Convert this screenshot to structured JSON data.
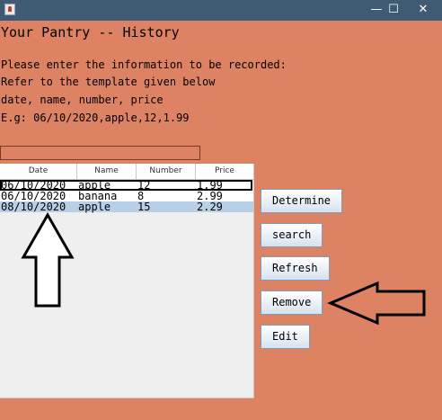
{
  "window": {
    "minimize_glyph": "—",
    "maximize_glyph": "☐",
    "close_glyph": "✕"
  },
  "heading": "Your Pantry -- History",
  "instructions": [
    "Please enter the information to be recorded:",
    "Refer to the template given below",
    "date, name, number, price",
    "E.g: 06/10/2020,apple,12,1.99"
  ],
  "input": {
    "value": ""
  },
  "table": {
    "columns": [
      "Date",
      "Name",
      "Number",
      "Price"
    ],
    "rows": [
      [
        "06/10/2020",
        "apple",
        "12",
        "1.99"
      ],
      [
        "06/10/2020",
        "banana",
        "8",
        "2.99"
      ],
      [
        "08/10/2020",
        "apple",
        "15",
        "2.29"
      ]
    ],
    "selected_row": 2
  },
  "buttons": {
    "determine": "Determine",
    "search": "search",
    "refresh": "Refresh",
    "remove": "Remove",
    "edit": "Edit"
  },
  "colors": {
    "background": "#de8264",
    "titlebar": "#3f5a73",
    "selection": "#b8cfe5"
  }
}
